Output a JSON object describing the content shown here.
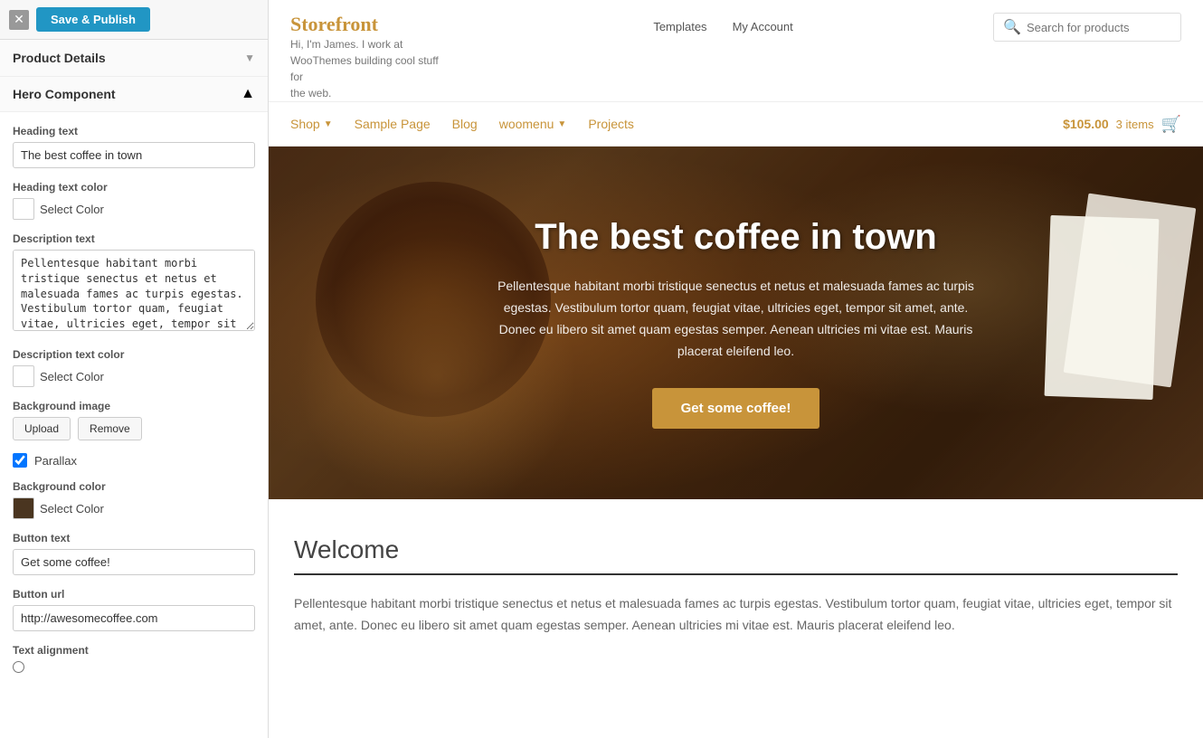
{
  "topbar": {
    "close_label": "✕",
    "save_publish_label": "Save & Publish"
  },
  "left_panel": {
    "product_details_title": "Product Details",
    "product_details_arrow": "▼",
    "hero_component_title": "Hero Component",
    "hero_component_arrow": "▲",
    "fields": {
      "heading_text_label": "Heading text",
      "heading_text_value": "The best coffee in town",
      "heading_color_label": "Heading text color",
      "heading_color_select": "Select Color",
      "description_text_label": "Description text",
      "description_text_value": "Pellentesque habitant morbi tristique senectus et netus et malesuada fames ac turpis egestas. Vestibulum tortor quam, feugiat vitae, ultricies eget, tempor sit amet, ante. Donec",
      "description_color_label": "Description text color",
      "description_color_select": "Select Color",
      "background_image_label": "Background image",
      "upload_label": "Upload",
      "remove_label": "Remove",
      "parallax_label": "Parallax",
      "background_color_label": "Background color",
      "background_color_select": "Select Color",
      "button_text_label": "Button text",
      "button_text_value": "Get some coffee!",
      "button_url_label": "Button url",
      "button_url_value": "http://awesomecoffee.com",
      "text_alignment_label": "Text alignment"
    }
  },
  "storefront": {
    "title": "Storefront",
    "subtitle_line1": "Hi, I'm James. I work at",
    "subtitle_line2": "WooThemes building cool stuff for",
    "subtitle_line3": "the web.",
    "nav": {
      "templates": "Templates",
      "my_account": "My Account"
    },
    "search_placeholder": "Search for products",
    "main_nav": {
      "shop": "Shop",
      "sample_page": "Sample Page",
      "blog": "Blog",
      "woomenu": "woomenu",
      "projects": "Projects"
    },
    "cart": {
      "amount": "$105.00",
      "items": "3 items"
    }
  },
  "hero": {
    "heading": "The best coffee in town",
    "description": "Pellentesque habitant morbi tristique senectus et netus et malesuada fames ac turpis egestas. Vestibulum tortor quam, feugiat vitae, ultricies eget, tempor sit amet, ante. Donec eu libero sit amet quam egestas semper. Aenean ultricies mi vitae est. Mauris placerat eleifend leo.",
    "button_label": "Get some coffee!"
  },
  "welcome": {
    "title": "Welcome",
    "body": "Pellentesque habitant morbi tristique senectus et netus et malesuada fames ac turpis egestas. Vestibulum tortor quam, feugiat vitae, ultricies eget, tempor sit amet, ante. Donec eu libero sit amet quam egestas semper. Aenean ultricies mi vitae est. Mauris placerat eleifend leo."
  }
}
